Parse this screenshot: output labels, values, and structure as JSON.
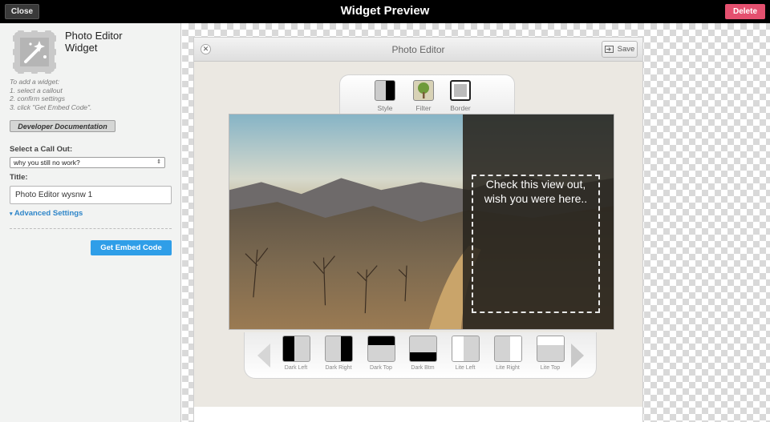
{
  "topbar": {
    "close_label": "Close",
    "title": "Widget Preview",
    "delete_label": "Delete"
  },
  "sidebar": {
    "widget_name_line1": "Photo Editor",
    "widget_name_line2": "Widget",
    "instructions": [
      "To add a widget:",
      "1. select a callout",
      "2. confirm settings",
      "3. click \"Get Embed Code\"."
    ],
    "doc_button": "Developer Documentation",
    "callout_label": "Select a Call Out:",
    "callout_selected": "why you still no work?",
    "title_label": "Title:",
    "title_value": "Photo Editor wysnw 1",
    "advanced_label": "Advanced Settings",
    "embed_button": "Get Embed Code"
  },
  "editor": {
    "window_title": "Photo Editor",
    "save_label": "Save",
    "tools": [
      {
        "label": "Style",
        "icon": "style-icon"
      },
      {
        "label": "Filter",
        "icon": "tree-filter-icon"
      },
      {
        "label": "Border",
        "icon": "border-icon"
      }
    ],
    "callout_text_line1": "Check this view out,",
    "callout_text_line2": "wish you were here..",
    "styles": [
      {
        "label": "Dark Left"
      },
      {
        "label": "Dark Right"
      },
      {
        "label": "Dark Top"
      },
      {
        "label": "Dark Btm"
      },
      {
        "label": "Lite Left"
      },
      {
        "label": "Lite Right"
      },
      {
        "label": "Lite Top"
      }
    ]
  },
  "colors": {
    "accent_blue": "#2f9ee8",
    "delete_pink": "#e4506f",
    "link_blue": "#2f86c9"
  }
}
